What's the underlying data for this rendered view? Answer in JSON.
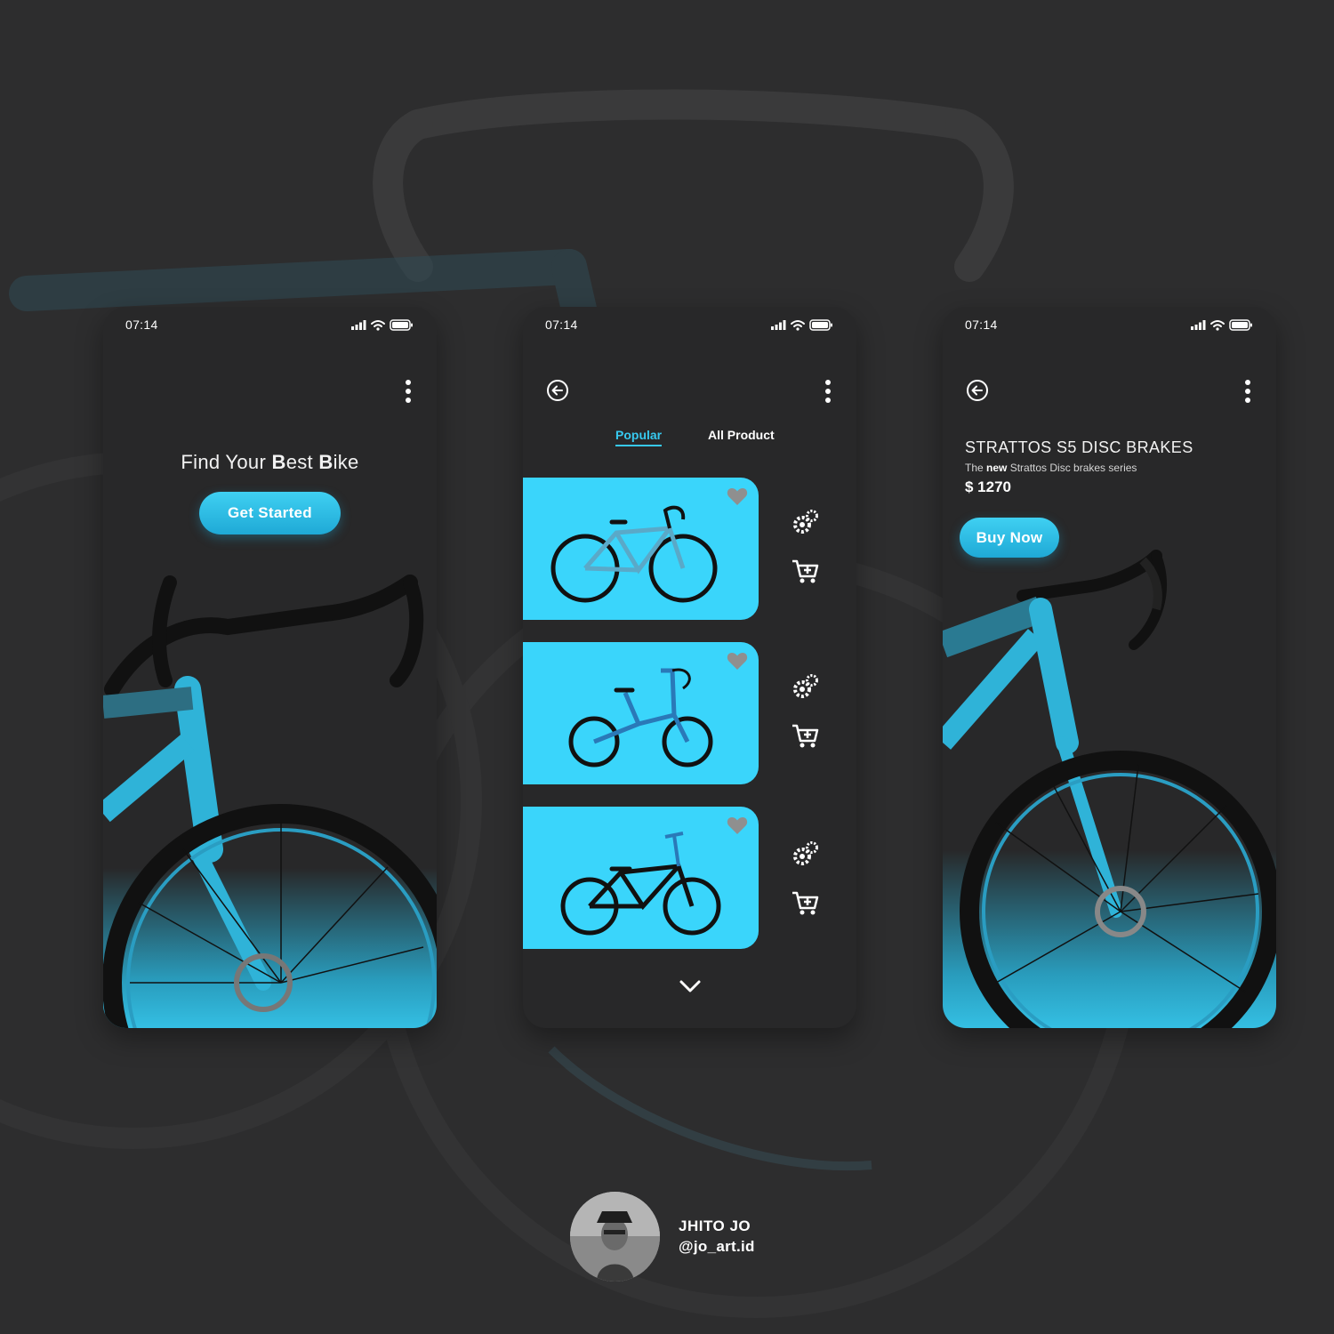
{
  "status_bar": {
    "time": "07:14"
  },
  "screen_1": {
    "title_part1": "Find Your ",
    "title_b1": "B",
    "title_part2": "est ",
    "title_b2": "B",
    "title_part3": "ike",
    "cta_label": "Get Started"
  },
  "screen_2": {
    "tabs": [
      {
        "label": "Popular",
        "active": true
      },
      {
        "label": "All Product",
        "active": false
      }
    ],
    "products": [
      {
        "kind": "road bike",
        "color": "#3ad5fb"
      },
      {
        "kind": "folding bike",
        "color": "#3ad5fb"
      },
      {
        "kind": "bmx bike",
        "color": "#3ad5fb"
      }
    ],
    "icons": [
      "back-arrow-icon",
      "more-vertical-icon",
      "heart-icon",
      "gears-icon",
      "add-to-cart-icon",
      "chevron-down-icon"
    ]
  },
  "screen_3": {
    "product_name": "STRATTOS S5 DISC BRAKES",
    "subtitle_prefix": "The ",
    "subtitle_bold": "new",
    "subtitle_suffix": " Strattos Disc brakes series",
    "price": "$ 1270",
    "cta_label": "Buy Now"
  },
  "author": {
    "name": "JHITO JO",
    "handle": "@jo_art.id"
  },
  "colors": {
    "background": "#2d2d2e",
    "phone": "#282829",
    "accent": "#37c9ef",
    "card": "#3ad5fb"
  }
}
